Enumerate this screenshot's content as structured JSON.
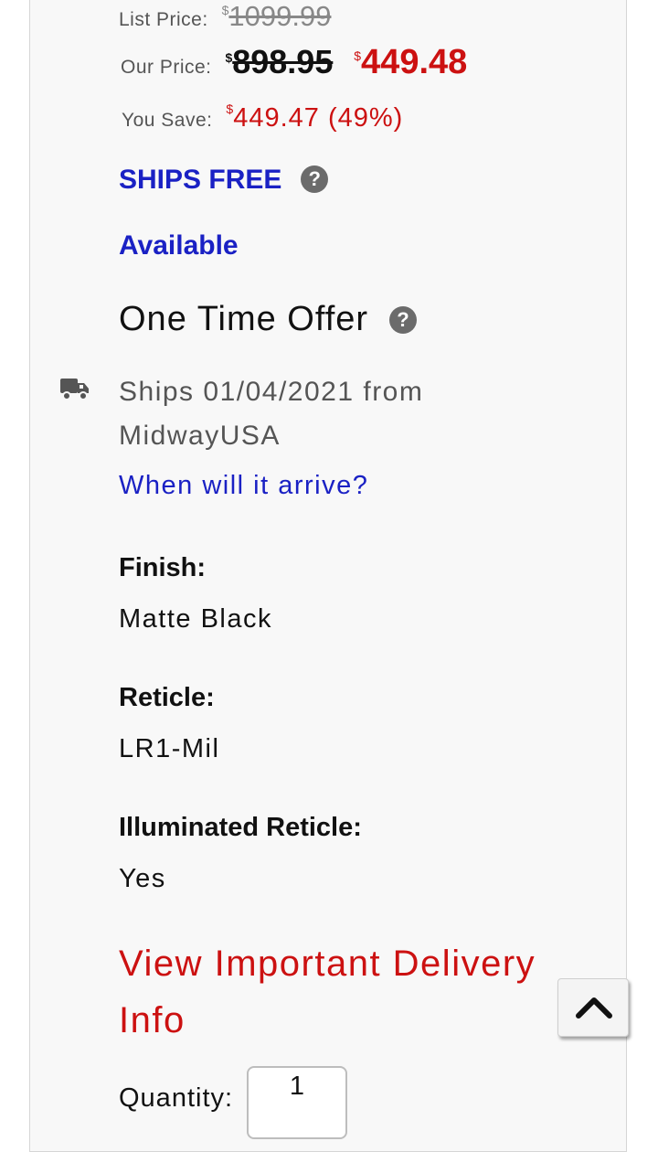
{
  "pricing": {
    "list_label": "List Price:",
    "list_currency": "$",
    "list_price": "1099.99",
    "our_label": "Our Price:",
    "our_currency": "$",
    "our_price_original": "898.95",
    "sale_currency": "$",
    "sale_price": "449.48",
    "save_label": "You Save:",
    "save_currency": "$",
    "save_amount": "449.47 (49%)"
  },
  "shipping": {
    "ships_free": "SHIPS FREE",
    "availability": "Available"
  },
  "offer": {
    "title": "One Time Offer",
    "ships_line1": "Ships 01/04/2021 from",
    "ships_line2": "MidwayUSA",
    "arrive_link": "When will it arrive?"
  },
  "attributes": [
    {
      "label": "Finish:",
      "value": "Matte Black"
    },
    {
      "label": "Reticle:",
      "value": "LR1-Mil"
    },
    {
      "label": "Illuminated Reticle:",
      "value": "Yes"
    }
  ],
  "delivery": {
    "line1": "View Important Delivery",
    "line2": "Info"
  },
  "quantity": {
    "label": "Quantity:",
    "value": "1"
  },
  "icons": {
    "help": "question-circle-icon",
    "truck": "truck-icon",
    "scroll_top": "chevron-up-icon"
  },
  "colors": {
    "sale_red": "#cc1111",
    "link_blue": "#1a21c4"
  }
}
